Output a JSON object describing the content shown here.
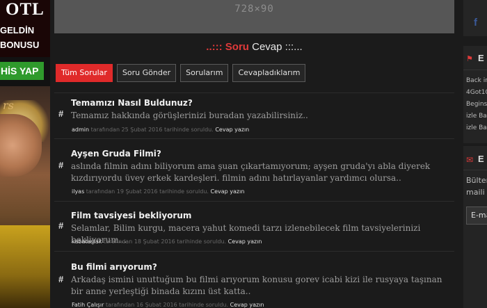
{
  "left_ad": {
    "line1": "OTL",
    "line2": "GELDİN",
    "line3": "BONUSU",
    "button": "HİS YAP",
    "script": "rs"
  },
  "top_banner": {
    "size_text": "728×90"
  },
  "heading": {
    "prefix": "..::: ",
    "highlight": "Soru",
    "word": " Cevap",
    "suffix": " :::..."
  },
  "tabs": [
    "Tüm Sorular",
    "Soru Gönder",
    "Sorularım",
    "Cevapladıklarım"
  ],
  "questions": [
    {
      "title": "Temamızı Nasıl Buldunuz?",
      "body": "Temamız hakkında görüşlerinizi buradan yazabilirsiniz..",
      "user": "admin",
      "meta": "tarafından 25 Şubat 2016 tarihinde soruldu.",
      "reply": "Cevap yazın"
    },
    {
      "title": "Ayşen Gruda Filmi?",
      "body": "aslında filmin adını biliyorum ama şuan çıkartamıyorum; ayşen gruda'yı abla diyerek kızdırıyordu üvey erkek kardeşleri. filmin adını hatırlayanlar yardımcı olursa..",
      "user": "ilyas",
      "meta": "tarafından 19 Şubat 2016 tarihinde soruldu.",
      "reply": "Cevap yazın"
    },
    {
      "title": "Film tavsiyesi bekliyorum",
      "body": "Selamlar, Bilim kurgu, macera yahut komedi tarzı izlenebilecek film tavsiyelerinizi bekliyorum...",
      "user": "kabataslak",
      "meta": "tarafından 18 Şubat 2016 tarihinde soruldu.",
      "reply": "Cevap yazın"
    },
    {
      "title": "Bu filmi arıyorum?",
      "body": "Arkadaş ismini unuttuğum bu filmi arıyorum konusu gorev icabi kizi ile rusyaya taşınan bir anne yerleştiği binada kızını üst katta..",
      "user": "Fatih Çalışır",
      "meta": "tarafından 16 Şubat 2016 tarihinde soruldu.",
      "reply": "Cevap yazın"
    }
  ],
  "sidebar": {
    "social_icon": "facebook-icon",
    "title1": "E",
    "links": [
      "Back in",
      "4Got10",
      "Begins",
      "izle Ba",
      "izle Bat"
    ],
    "title2": "E",
    "newsletter_lines": [
      "Bülter",
      "maili"
    ],
    "email_placeholder": "E-ma"
  },
  "colors": {
    "accent": "#e02a2a",
    "button_green": "#2f9a2c",
    "background": "#1b1b1b"
  }
}
